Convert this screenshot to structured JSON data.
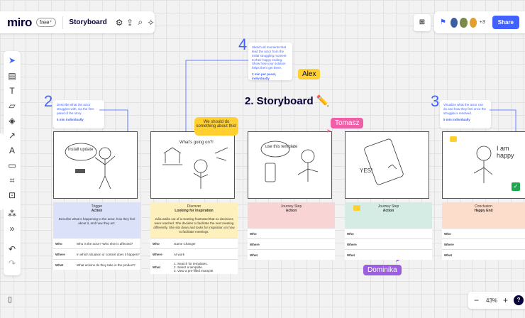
{
  "app": {
    "logo": "miro",
    "plan": "free⁺",
    "board_name": "Storyboard"
  },
  "toolbar_icons": [
    "settings-icon",
    "upload-icon",
    "search-icon",
    "magic-icon"
  ],
  "right_bar": {
    "extra_count": "+3",
    "share_label": "Share"
  },
  "zoom": {
    "minus": "−",
    "level": "43%",
    "plus": "+",
    "help": "?"
  },
  "title": "2. Storyboard ✏️",
  "numbers": {
    "n2": "2",
    "n4": "4",
    "n3": "3"
  },
  "notes": [
    {
      "text": "Describe what the actor struggles with, via the first panel of the story.",
      "time": "5 min individually"
    },
    {
      "text": "Sketch all moments that lead the actor from the initial struggling moment to their happy ending. Show how your solution helps them get there.",
      "time": "2 min per panel, individually"
    },
    {
      "text": "Visualize what the actor can do and how they feel once the struggle is resolved.",
      "time": "5 min individually"
    }
  ],
  "speech": "We should do something about this!",
  "cursors": {
    "alex": "Alex",
    "tomasz": "Tomasz",
    "dominika": "Dominika"
  },
  "colors": {
    "accent": "#4262ff",
    "trigger": "#dbe1f8",
    "discover": "#fdf0bd",
    "journey1": "#f9d4d4",
    "journey2": "#d4ece4",
    "conclusion": "#fcdccb"
  },
  "cards": [
    {
      "label": "Trigger",
      "title": "Action",
      "desc": "Describe what is happening to the actor, how they feel about it, and how they act.",
      "rows": [
        [
          "Who",
          "Who is the actor? Who else is affected?"
        ],
        [
          "Where",
          "In which situation or context does it happen?"
        ],
        [
          "What",
          "What actions do they take in the product?"
        ]
      ]
    },
    {
      "label": "Discover",
      "title": "Looking for inspiration",
      "desc": "Julia walks out of a meeting frustrated that no decisions were reached. She decides to facilitate the next meeting differently. She sits down and looks for inspiration on how to facilitate meetings.",
      "rows": [
        [
          "Who",
          "Game Changer"
        ],
        [
          "Where",
          "At work"
        ],
        [
          "What",
          "1. Search for templates.\n2. Select a template.\n3. View a pre-filled example."
        ]
      ]
    },
    {
      "label": "Journey Step",
      "title": "Action",
      "desc": "",
      "rows": [
        [
          "Who",
          ""
        ],
        [
          "Where",
          ""
        ],
        [
          "What",
          ""
        ]
      ]
    },
    {
      "label": "Journey Step",
      "title": "Action",
      "desc": "",
      "rows": [
        [
          "Who",
          ""
        ],
        [
          "Where",
          ""
        ],
        [
          "What",
          ""
        ]
      ]
    },
    {
      "label": "Conclusion",
      "title": "Happy End",
      "desc": "",
      "rows": [
        [
          "Who",
          ""
        ],
        [
          "Where",
          ""
        ],
        [
          "What",
          ""
        ]
      ]
    }
  ],
  "sketch_words": {
    "s1": "install update",
    "s2": "What's going on?!",
    "s3": "use this template",
    "s4": "YES!",
    "s5": "I am happy"
  }
}
